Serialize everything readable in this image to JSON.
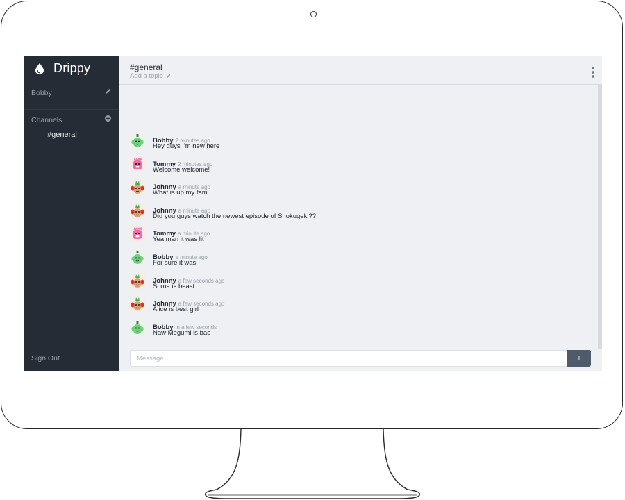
{
  "app": {
    "name": "Drippy"
  },
  "sidebar": {
    "user": "Bobby",
    "channels_label": "Channels",
    "channels": [
      "#general"
    ],
    "sign_out": "Sign Out",
    "bg_color": "#262c36"
  },
  "header": {
    "channel": "#general",
    "topic_placeholder": "Add a topic"
  },
  "messages": [
    {
      "author": "Bobby",
      "time": "2 minutes ago",
      "text": "Hey guys I'm new here",
      "avatar": "green-cactus"
    },
    {
      "author": "Tommy",
      "time": "2 minutes ago",
      "text": "Welcome welcome!",
      "avatar": "pink-creature"
    },
    {
      "author": "Johnny",
      "time": "a minute ago",
      "text": "What is up my fam",
      "avatar": "red-pineapple"
    },
    {
      "author": "Johnny",
      "time": "a minute ago",
      "text": "Did you guys watch the newest episode of Shokugeki??",
      "avatar": "red-pineapple"
    },
    {
      "author": "Tommy",
      "time": "a minute ago",
      "text": "Yea man it was lit",
      "avatar": "pink-creature"
    },
    {
      "author": "Bobby",
      "time": "a minute ago",
      "text": "For sure it was!",
      "avatar": "green-cactus"
    },
    {
      "author": "Johnny",
      "time": "a few seconds ago",
      "text": "Soma is beast",
      "avatar": "red-pineapple"
    },
    {
      "author": "Johnny",
      "time": "a few seconds ago",
      "text": "Alice is best girl",
      "avatar": "red-pineapple"
    },
    {
      "author": "Bobby",
      "time": "in a few seconds",
      "text": "Naw Megumi is bae",
      "avatar": "green-cactus"
    }
  ],
  "composer": {
    "placeholder": "Message",
    "send_label": "+"
  },
  "colors": {
    "accent": "#4f5b6a",
    "main_bg": "#eef0f4"
  }
}
